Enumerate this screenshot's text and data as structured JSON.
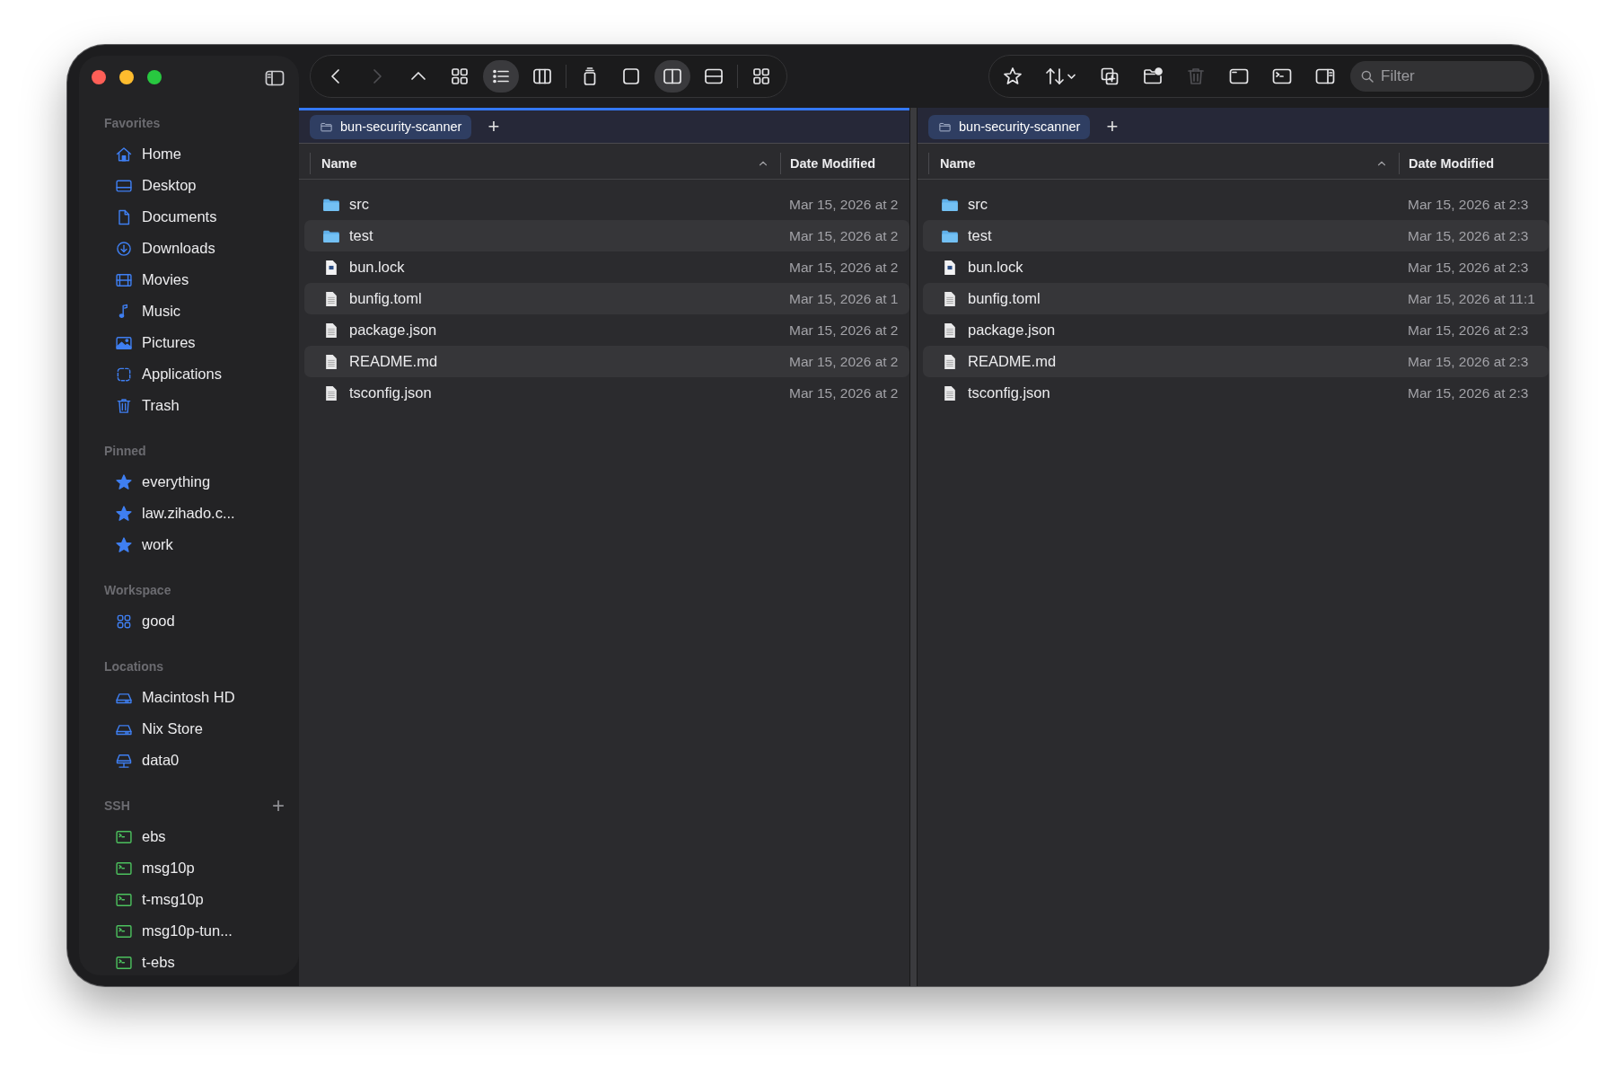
{
  "sidebar": {
    "sections": [
      {
        "title": "Favorites",
        "items": [
          {
            "label": "Home",
            "kind": "home"
          },
          {
            "label": "Desktop",
            "kind": "desktop"
          },
          {
            "label": "Documents",
            "kind": "document"
          },
          {
            "label": "Downloads",
            "kind": "download"
          },
          {
            "label": "Movies",
            "kind": "film"
          },
          {
            "label": "Music",
            "kind": "music"
          },
          {
            "label": "Pictures",
            "kind": "picture"
          },
          {
            "label": "Applications",
            "kind": "apps"
          },
          {
            "label": "Trash",
            "kind": "trash"
          }
        ]
      },
      {
        "title": "Pinned",
        "items": [
          {
            "label": "everything",
            "kind": "star"
          },
          {
            "label": "law.zihado.c...",
            "kind": "star"
          },
          {
            "label": "work",
            "kind": "star"
          }
        ]
      },
      {
        "title": "Workspace",
        "items": [
          {
            "label": "good",
            "kind": "workspace"
          }
        ]
      },
      {
        "title": "Locations",
        "items": [
          {
            "label": "Macintosh HD",
            "kind": "disk"
          },
          {
            "label": "Nix Store",
            "kind": "disk"
          },
          {
            "label": "data0",
            "kind": "network-disk"
          }
        ]
      },
      {
        "title": "SSH",
        "add": "+",
        "items": [
          {
            "label": "ebs",
            "kind": "terminal"
          },
          {
            "label": "msg10p",
            "kind": "terminal"
          },
          {
            "label": "t-msg10p",
            "kind": "terminal"
          },
          {
            "label": "msg10p-tun...",
            "kind": "terminal"
          },
          {
            "label": "t-ebs",
            "kind": "terminal"
          }
        ]
      }
    ]
  },
  "toolbar": {
    "left": [
      {
        "kind": "back",
        "selected": false,
        "disabled": false
      },
      {
        "kind": "forward",
        "selected": false,
        "disabled": true
      },
      {
        "kind": "up",
        "selected": false,
        "disabled": false
      },
      {
        "kind": "grid",
        "selected": false,
        "disabled": false
      },
      {
        "kind": "list",
        "selected": true,
        "disabled": false
      },
      {
        "kind": "columns",
        "selected": false,
        "disabled": false
      },
      {
        "kind": "separator"
      },
      {
        "kind": "stack",
        "selected": false,
        "disabled": false
      },
      {
        "kind": "single",
        "selected": false,
        "disabled": false
      },
      {
        "kind": "split-v",
        "selected": true,
        "disabled": false
      },
      {
        "kind": "split-h",
        "selected": false,
        "disabled": false
      },
      {
        "kind": "separator"
      },
      {
        "kind": "quad",
        "selected": false,
        "disabled": false
      }
    ],
    "right": [
      {
        "kind": "star",
        "selected": false,
        "disabled": false
      },
      {
        "kind": "sort",
        "selected": false,
        "disabled": false
      },
      {
        "kind": "duplicate",
        "selected": false,
        "disabled": false
      },
      {
        "kind": "new-folder",
        "selected": false,
        "disabled": false
      },
      {
        "kind": "trash",
        "selected": false,
        "disabled": true
      },
      {
        "kind": "window",
        "selected": false,
        "disabled": false
      },
      {
        "kind": "terminal",
        "selected": false,
        "disabled": false
      },
      {
        "kind": "sidebar",
        "selected": false,
        "disabled": false
      }
    ],
    "filter": {
      "placeholder": "Filter"
    }
  },
  "panes": [
    {
      "active": true,
      "tabs": [
        {
          "label": "bun-security-scanner",
          "selected": true
        }
      ],
      "new_tab": "+",
      "columns": [
        {
          "label": "Name",
          "sorted": true
        },
        {
          "label": "Date Modified",
          "sorted": false
        }
      ],
      "rows": [
        {
          "name": "src",
          "kind": "folder",
          "date": "Mar 15, 2026 at 2"
        },
        {
          "name": "test",
          "kind": "folder",
          "date": "Mar 15, 2026 at 2"
        },
        {
          "name": "bun.lock",
          "kind": "lockfile",
          "date": "Mar 15, 2026 at 2"
        },
        {
          "name": "bunfig.toml",
          "kind": "file",
          "date": "Mar 15, 2026 at 1"
        },
        {
          "name": "package.json",
          "kind": "file",
          "date": "Mar 15, 2026 at 2"
        },
        {
          "name": "README.md",
          "kind": "file",
          "date": "Mar 15, 2026 at 2"
        },
        {
          "name": "tsconfig.json",
          "kind": "file",
          "date": "Mar 15, 2026 at 2"
        }
      ]
    },
    {
      "active": false,
      "tabs": [
        {
          "label": "bun-security-scanner",
          "selected": true
        }
      ],
      "new_tab": "+",
      "columns": [
        {
          "label": "Name",
          "sorted": true
        },
        {
          "label": "Date Modified",
          "sorted": false
        }
      ],
      "rows": [
        {
          "name": "src",
          "kind": "folder",
          "date": "Mar 15, 2026 at 2:3"
        },
        {
          "name": "test",
          "kind": "folder",
          "date": "Mar 15, 2026 at 2:3"
        },
        {
          "name": "bun.lock",
          "kind": "lockfile",
          "date": "Mar 15, 2026 at 2:3"
        },
        {
          "name": "bunfig.toml",
          "kind": "file",
          "date": "Mar 15, 2026 at 11:1"
        },
        {
          "name": "package.json",
          "kind": "file",
          "date": "Mar 15, 2026 at 2:3"
        },
        {
          "name": "README.md",
          "kind": "file",
          "date": "Mar 15, 2026 at 2:3"
        },
        {
          "name": "tsconfig.json",
          "kind": "file",
          "date": "Mar 15, 2026 at 2:3"
        }
      ]
    }
  ]
}
